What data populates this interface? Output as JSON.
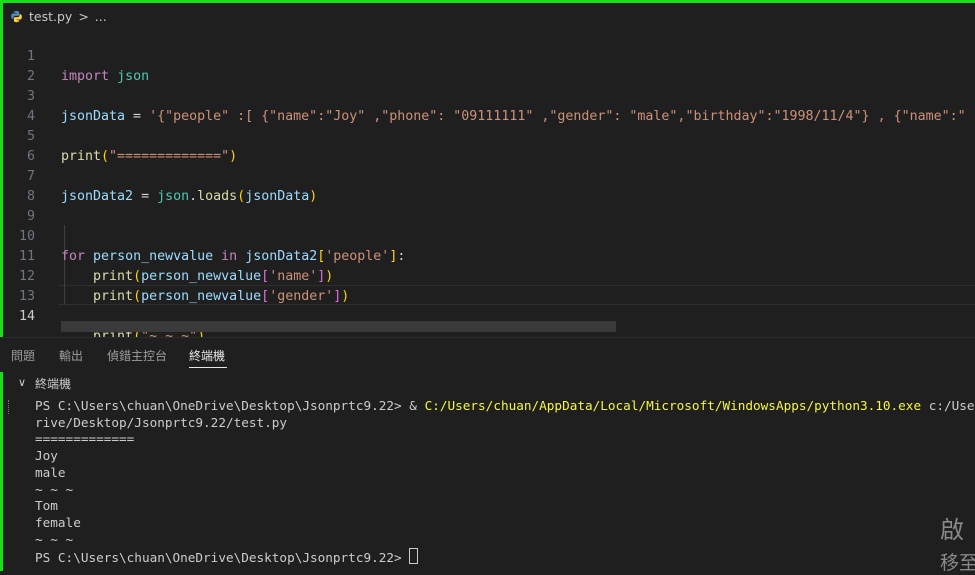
{
  "breadcrumb": {
    "file": "test.py",
    "separator": ">",
    "rest": "..."
  },
  "editor": {
    "lines": [
      {
        "n": "1"
      },
      {
        "n": "2"
      },
      {
        "n": "3"
      },
      {
        "n": "4"
      },
      {
        "n": "5"
      },
      {
        "n": "6"
      },
      {
        "n": "7"
      },
      {
        "n": "8"
      },
      {
        "n": "9"
      },
      {
        "n": "10"
      },
      {
        "n": "11"
      },
      {
        "n": "12"
      },
      {
        "n": "13"
      },
      {
        "n": "14"
      }
    ],
    "active_line": "14",
    "code": {
      "l1_kw": "import",
      "l1_mod": "json",
      "l3_var": "jsonData",
      "l3_eq": " = ",
      "l3_str": "'{\"people\" :[ {\"name\":\"Joy\" ,\"phone\": \"09111111\" ,\"gender\": \"male\",\"birthday\":\"1998/11/4\"} , {\"name\":\"",
      "l5_fn": "print",
      "l5_str": "\"=============\"",
      "l7_var": "jsonData2",
      "l7_eq": " = ",
      "l7_mod": "json",
      "l7_dot": ".",
      "l7_fn": "loads",
      "l7_arg": "jsonData",
      "l10_for": "for",
      "l10_var": "person_newvalue",
      "l10_in": "in",
      "l10_obj": "jsonData2",
      "l10_key": "'people'",
      "l11_fn": "print",
      "l11_obj": "person_newvalue",
      "l11_key": "'name'",
      "l12_fn": "print",
      "l12_obj": "person_newvalue",
      "l12_key": "'gender'",
      "l14_fn": "print",
      "l14_str": "\"~ ~ ~\""
    }
  },
  "panel": {
    "tabs": [
      "問題",
      "輸出",
      "偵錯主控台",
      "終端機"
    ],
    "active_tab": "終端機",
    "terminal_header": "終端機"
  },
  "terminal": {
    "prompt1": "PS C:\\Users\\chuan\\OneDrive\\Desktop\\Jsonprtc9.22> ",
    "amp": "& ",
    "exe": "C:/Users/chuan/AppData/Local/Microsoft/WindowsApps/python3.10.exe",
    "arg_start": " c:/Use",
    "arg_wrap": "rive/Desktop/Jsonprtc9.22/test.py",
    "output": [
      "=============",
      "Joy",
      "male",
      "~ ~ ~",
      "Tom",
      "female",
      "~ ~ ~"
    ],
    "prompt2": "PS C:\\Users\\chuan\\OneDrive\\Desktop\\Jsonprtc9.22> "
  },
  "watermark": {
    "line1": "啟",
    "line2": "移至"
  },
  "colors": {
    "frame": "#18e018",
    "background": "#1f1f1f"
  }
}
